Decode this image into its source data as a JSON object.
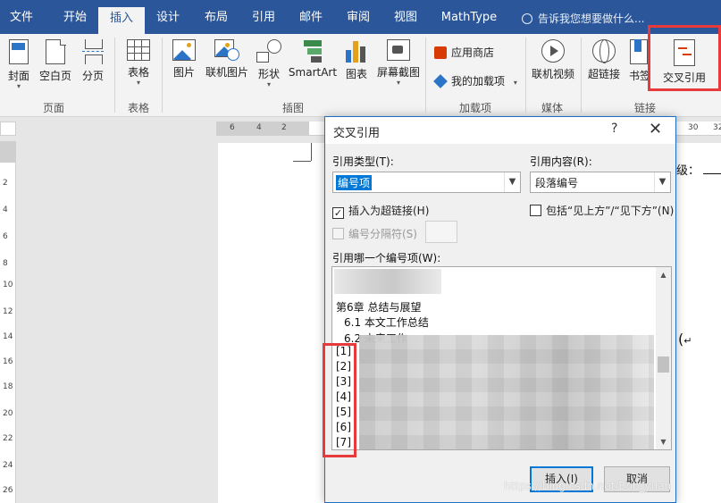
{
  "tabs": [
    "文件",
    "开始",
    "插入",
    "设计",
    "布局",
    "引用",
    "邮件",
    "审阅",
    "视图",
    "MathType"
  ],
  "active_tab": "插入",
  "tell_me": "告诉我您想要做什么...",
  "ribbon": {
    "pages": {
      "cover": "封面",
      "blank": "空白页",
      "break": "分页",
      "group": "页面"
    },
    "tables": {
      "table": "表格",
      "group": "表格"
    },
    "illustrations": {
      "picture": "图片",
      "online_picture": "联机图片",
      "shapes": "形状",
      "smartart": "SmartArt",
      "chart": "图表",
      "screenshot": "屏幕截图",
      "group": "插图"
    },
    "addins": {
      "store": "应用商店",
      "my_addins": "我的加载项",
      "group": "加载项"
    },
    "media": {
      "online_video": "联机视频",
      "group": "媒体"
    },
    "links": {
      "hyperlink": "超链接",
      "bookmark": "书签",
      "cross_reference": "交叉引用",
      "group": "链接"
    }
  },
  "ruler": {
    "h": [
      "6",
      "4",
      "2",
      "30",
      "32"
    ],
    "v": [
      "2",
      "4",
      "6",
      "8",
      "10",
      "12",
      "14",
      "16",
      "18",
      "20",
      "22",
      "24",
      "26"
    ]
  },
  "document": {
    "text_right": "级：",
    "arrow": "↵"
  },
  "dialog": {
    "title": "交叉引用",
    "help": "?",
    "close": "✕",
    "ref_type_label": "引用类型(T):",
    "ref_type_value": "编号项",
    "ref_content_label": "引用内容(R):",
    "ref_content_value": "段落编号",
    "insert_hyperlink": "插入为超链接(H)",
    "include_above_below": "包括“见上方”/“见下方”(N)",
    "separator_label": "编号分隔符(S)",
    "which_item_label": "引用哪一个编号项(W):",
    "items": [
      "第6章 总结与展望",
      "6.1 本文工作总结",
      "6.2 未来工作",
      "[1]",
      "[2]",
      "[3]",
      "[4]",
      "[5]",
      "[6]",
      "[7]"
    ],
    "insert_button": "插入(I)",
    "cancel_button": "取消"
  },
  "watermark": "https://blog.csdn.net/Bob_yuan",
  "colors": {
    "accent": "#2b579a",
    "highlight": "#e83a3a",
    "selection": "#0078d7"
  }
}
